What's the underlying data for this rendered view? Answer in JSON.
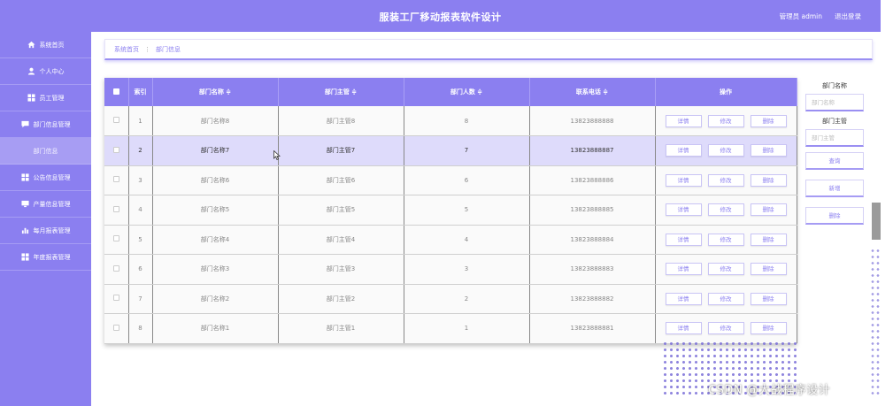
{
  "header": {
    "title": "服装工厂移动报表软件设计",
    "user_label": "管理员 admin",
    "logout_label": "退出登录"
  },
  "sidebar": {
    "items": [
      {
        "label": "系统首页",
        "icon": "home-icon"
      },
      {
        "label": "个人中心",
        "icon": "user-icon"
      },
      {
        "label": "员工管理",
        "icon": "grid-icon"
      },
      {
        "label": "部门信息管理",
        "icon": "chat-icon"
      },
      {
        "label": "部门信息",
        "icon": ""
      },
      {
        "label": "公告信息管理",
        "icon": "grid-icon"
      },
      {
        "label": "产量信息管理",
        "icon": "monitor-icon"
      },
      {
        "label": "每月报表管理",
        "icon": "bar-chart-icon"
      },
      {
        "label": "年度报表管理",
        "icon": "grid-icon"
      }
    ]
  },
  "breadcrumb": {
    "home": "系统首页",
    "separator": "⋮",
    "current": "部门信息"
  },
  "table": {
    "columns": [
      "索引",
      "部门名称 ≑",
      "部门主管 ≑",
      "部门人数 ≑",
      "联系电话 ≑",
      "操作"
    ],
    "rows": [
      {
        "index": "1",
        "name": "部门名称8",
        "manager": "部门主管8",
        "count": "8",
        "phone": "13823888888"
      },
      {
        "index": "2",
        "name": "部门名称7",
        "manager": "部门主管7",
        "count": "7",
        "phone": "13823888887"
      },
      {
        "index": "3",
        "name": "部门名称6",
        "manager": "部门主管6",
        "count": "6",
        "phone": "13823888886"
      },
      {
        "index": "4",
        "name": "部门名称5",
        "manager": "部门主管5",
        "count": "5",
        "phone": "13823888885"
      },
      {
        "index": "5",
        "name": "部门名称4",
        "manager": "部门主管4",
        "count": "4",
        "phone": "13823888884"
      },
      {
        "index": "6",
        "name": "部门名称3",
        "manager": "部门主管3",
        "count": "3",
        "phone": "13823888883"
      },
      {
        "index": "7",
        "name": "部门名称2",
        "manager": "部门主管2",
        "count": "2",
        "phone": "13823888882"
      },
      {
        "index": "8",
        "name": "部门名称1",
        "manager": "部门主管1",
        "count": "1",
        "phone": "13823888881"
      }
    ],
    "actions": {
      "detail": "详情",
      "edit": "修改",
      "delete": "删除"
    }
  },
  "filter": {
    "name_label": "部门名称",
    "name_placeholder": "部门名称",
    "manager_label": "部门主管",
    "manager_placeholder": "部门主管",
    "search": "查询",
    "add": "新增",
    "delete": "删除"
  },
  "watermark": "CSDN @大战程序设计",
  "colors": {
    "accent": "#8b7ff0",
    "selected_row": "#dedbfb"
  }
}
